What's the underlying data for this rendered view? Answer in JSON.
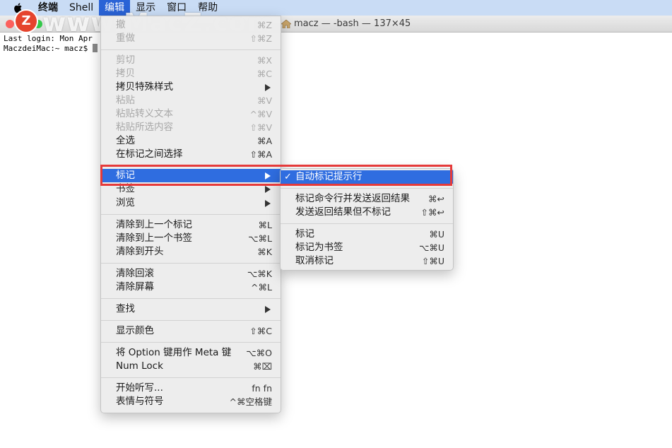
{
  "menubar": {
    "items": [
      "终端",
      "Shell",
      "编辑",
      "显示",
      "窗口",
      "帮助"
    ],
    "active_index": 2
  },
  "watermark": {
    "logo": "Z",
    "text": "www.MacZ.com"
  },
  "window": {
    "title": "macz — -bash — 137×45"
  },
  "terminal": {
    "line1": "Last login: Mon Apr",
    "line2": "MaczdeiMac:~ macz$ "
  },
  "edit_menu": {
    "undo": {
      "label": "撤",
      "shortcut": "⌘Z"
    },
    "redo": {
      "label": "重做",
      "shortcut": "⇧⌘Z"
    },
    "cut": {
      "label": "剪切",
      "shortcut": "⌘X"
    },
    "copy": {
      "label": "拷贝",
      "shortcut": "⌘C"
    },
    "copy_special": {
      "label": "拷贝特殊样式"
    },
    "paste": {
      "label": "粘贴",
      "shortcut": "⌘V"
    },
    "paste_escaped": {
      "label": "粘贴转义文本",
      "shortcut": "^⌘V"
    },
    "paste_selection": {
      "label": "粘贴所选内容",
      "shortcut": "⇧⌘V"
    },
    "select_all": {
      "label": "全选",
      "shortcut": "⌘A"
    },
    "select_between_marks": {
      "label": "在标记之间选择",
      "shortcut": "⇧⌘A"
    },
    "marks": {
      "label": "标记"
    },
    "bookmarks": {
      "label": "书签"
    },
    "navigate": {
      "label": "浏览"
    },
    "clear_to_prev_mark": {
      "label": "清除到上一个标记",
      "shortcut": "⌘L"
    },
    "clear_to_prev_bookmark": {
      "label": "清除到上一个书签",
      "shortcut": "⌥⌘L"
    },
    "clear_to_start": {
      "label": "清除到开头",
      "shortcut": "⌘K"
    },
    "clear_scrollback": {
      "label": "清除回滚",
      "shortcut": "⌥⌘K"
    },
    "clear_screen": {
      "label": "清除屏幕",
      "shortcut": "^⌘L"
    },
    "find": {
      "label": "查找"
    },
    "show_colors": {
      "label": "显示颜色",
      "shortcut": "⇧⌘C"
    },
    "option_as_meta": {
      "label": "将 Option 键用作 Meta 键",
      "shortcut": "⌥⌘O"
    },
    "num_lock": {
      "label": "Num Lock",
      "shortcut": "⌘⌧"
    },
    "start_dictation": {
      "label": "开始听写...",
      "shortcut": "fn fn"
    },
    "emoji": {
      "label": "表情与符号",
      "shortcut": "^⌘空格键"
    }
  },
  "marks_submenu": {
    "auto_mark": {
      "label": "自动标记提示行",
      "check": "✓"
    },
    "mark_and_send": {
      "label": "标记命令行并发送返回结果",
      "shortcut": "⌘↩"
    },
    "send_no_mark": {
      "label": "发送返回结果但不标记",
      "shortcut": "⇧⌘↩"
    },
    "mark": {
      "label": "标记",
      "shortcut": "⌘U"
    },
    "mark_as_bookmark": {
      "label": "标记为书签",
      "shortcut": "⌥⌘U"
    },
    "unmark": {
      "label": "取消标记",
      "shortcut": "⇧⌘U"
    }
  },
  "colors": {
    "highlight": "#2f6de0",
    "annotation": "#e53a3a",
    "menubar": "#c9dcf5"
  }
}
